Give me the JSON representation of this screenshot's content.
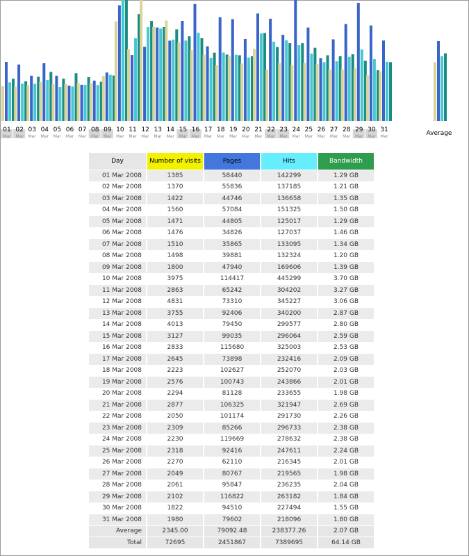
{
  "colors": {
    "visits": "#d9d49a",
    "pages": "#3a64c8",
    "hits": "#44c8d4",
    "bandwidth": "#1a8c80",
    "header_visits": "#f2f200",
    "header_pages": "#4477dd",
    "header_hits": "#66eeff",
    "header_bandwidth": "#2e9e4e"
  },
  "chart_data": {
    "type": "bar",
    "series_names": [
      "Number of visits",
      "Pages",
      "Hits",
      "Bandwidth"
    ],
    "categories": [
      "01",
      "02",
      "03",
      "04",
      "05",
      "06",
      "07",
      "08",
      "09",
      "10",
      "11",
      "12",
      "13",
      "14",
      "15",
      "16",
      "17",
      "18",
      "19",
      "20",
      "21",
      "22",
      "23",
      "24",
      "25",
      "26",
      "27",
      "28",
      "29",
      "30",
      "31"
    ],
    "category_sublabel": "Mar",
    "average_label": "Average",
    "series": [
      {
        "name": "Number of visits",
        "values": [
          1385,
          1370,
          1422,
          1560,
          1471,
          1476,
          1510,
          1498,
          1800,
          3975,
          2863,
          4831,
          3755,
          4013,
          3127,
          2833,
          2645,
          2223,
          2576,
          2294,
          2877,
          2050,
          2309,
          2230,
          2318,
          2270,
          2049,
          2061,
          2102,
          1822,
          1980
        ],
        "average": 2345.0
      },
      {
        "name": "Pages",
        "values": [
          58440,
          55836,
          44746,
          57084,
          44805,
          34826,
          35865,
          39881,
          47940,
          114417,
          65242,
          73310,
          92406,
          79450,
          99035,
          115680,
          73898,
          102627,
          100743,
          81128,
          106325,
          101174,
          85266,
          119669,
          92416,
          62110,
          80767,
          95847,
          116822,
          94510,
          79602
        ],
        "average": 79092.48
      },
      {
        "name": "Hits",
        "values": [
          142299,
          137185,
          136658,
          151325,
          125017,
          127037,
          133095,
          132324,
          169606,
          445299,
          304202,
          345227,
          340200,
          299577,
          296064,
          325003,
          232416,
          252070,
          243866,
          233655,
          321947,
          291730,
          296733,
          278632,
          247611,
          216345,
          219565,
          236235,
          263182,
          227494,
          218096
        ],
        "average": 238377.26
      },
      {
        "name": "Bandwidth",
        "values": [
          1.29,
          1.21,
          1.35,
          1.5,
          1.29,
          1.46,
          1.34,
          1.2,
          1.39,
          3.7,
          3.27,
          3.06,
          2.87,
          2.8,
          2.59,
          2.53,
          2.09,
          2.03,
          2.01,
          1.98,
          2.69,
          2.26,
          2.38,
          2.38,
          2.24,
          2.01,
          1.98,
          2.04,
          1.84,
          1.55,
          1.8
        ],
        "average": 2.07,
        "unit": "GB"
      }
    ]
  },
  "table": {
    "headers": {
      "day": "Day",
      "visits": "Number of visits",
      "pages": "Pages",
      "hits": "Hits",
      "bandwidth": "Bandwidth"
    },
    "rows": [
      [
        "01 Mar 2008",
        "1385",
        "58440",
        "142299",
        "1.29 GB"
      ],
      [
        "02 Mar 2008",
        "1370",
        "55836",
        "137185",
        "1.21 GB"
      ],
      [
        "03 Mar 2008",
        "1422",
        "44746",
        "136658",
        "1.35 GB"
      ],
      [
        "04 Mar 2008",
        "1560",
        "57084",
        "151325",
        "1.50 GB"
      ],
      [
        "05 Mar 2008",
        "1471",
        "44805",
        "125017",
        "1.29 GB"
      ],
      [
        "06 Mar 2008",
        "1476",
        "34826",
        "127037",
        "1.46 GB"
      ],
      [
        "07 Mar 2008",
        "1510",
        "35865",
        "133095",
        "1.34 GB"
      ],
      [
        "08 Mar 2008",
        "1498",
        "39881",
        "132324",
        "1.20 GB"
      ],
      [
        "09 Mar 2008",
        "1800",
        "47940",
        "169606",
        "1.39 GB"
      ],
      [
        "10 Mar 2008",
        "3975",
        "114417",
        "445299",
        "3.70 GB"
      ],
      [
        "11 Mar 2008",
        "2863",
        "65242",
        "304202",
        "3.27 GB"
      ],
      [
        "12 Mar 2008",
        "4831",
        "73310",
        "345227",
        "3.06 GB"
      ],
      [
        "13 Mar 2008",
        "3755",
        "92406",
        "340200",
        "2.87 GB"
      ],
      [
        "14 Mar 2008",
        "4013",
        "79450",
        "299577",
        "2.80 GB"
      ],
      [
        "15 Mar 2008",
        "3127",
        "99035",
        "296064",
        "2.59 GB"
      ],
      [
        "16 Mar 2008",
        "2833",
        "115680",
        "325003",
        "2.53 GB"
      ],
      [
        "17 Mar 2008",
        "2645",
        "73898",
        "232416",
        "2.09 GB"
      ],
      [
        "18 Mar 2008",
        "2223",
        "102627",
        "252070",
        "2.03 GB"
      ],
      [
        "19 Mar 2008",
        "2576",
        "100743",
        "243866",
        "2.01 GB"
      ],
      [
        "20 Mar 2008",
        "2294",
        "81128",
        "233655",
        "1.98 GB"
      ],
      [
        "21 Mar 2008",
        "2877",
        "106325",
        "321947",
        "2.69 GB"
      ],
      [
        "22 Mar 2008",
        "2050",
        "101174",
        "291730",
        "2.26 GB"
      ],
      [
        "23 Mar 2008",
        "2309",
        "85266",
        "296733",
        "2.38 GB"
      ],
      [
        "24 Mar 2008",
        "2230",
        "119669",
        "278632",
        "2.38 GB"
      ],
      [
        "25 Mar 2008",
        "2318",
        "92416",
        "247611",
        "2.24 GB"
      ],
      [
        "26 Mar 2008",
        "2270",
        "62110",
        "216345",
        "2.01 GB"
      ],
      [
        "27 Mar 2008",
        "2049",
        "80767",
        "219565",
        "1.98 GB"
      ],
      [
        "28 Mar 2008",
        "2061",
        "95847",
        "236235",
        "2.04 GB"
      ],
      [
        "29 Mar 2008",
        "2102",
        "116822",
        "263182",
        "1.84 GB"
      ],
      [
        "30 Mar 2008",
        "1822",
        "94510",
        "227494",
        "1.55 GB"
      ],
      [
        "31 Mar 2008",
        "1980",
        "79602",
        "218096",
        "1.80 GB"
      ]
    ],
    "average": [
      "Average",
      "2345.00",
      "79092.48",
      "238377.26",
      "2.07 GB"
    ],
    "total": [
      "Total",
      "72695",
      "2451867",
      "7389695",
      "64.14 GB"
    ]
  }
}
